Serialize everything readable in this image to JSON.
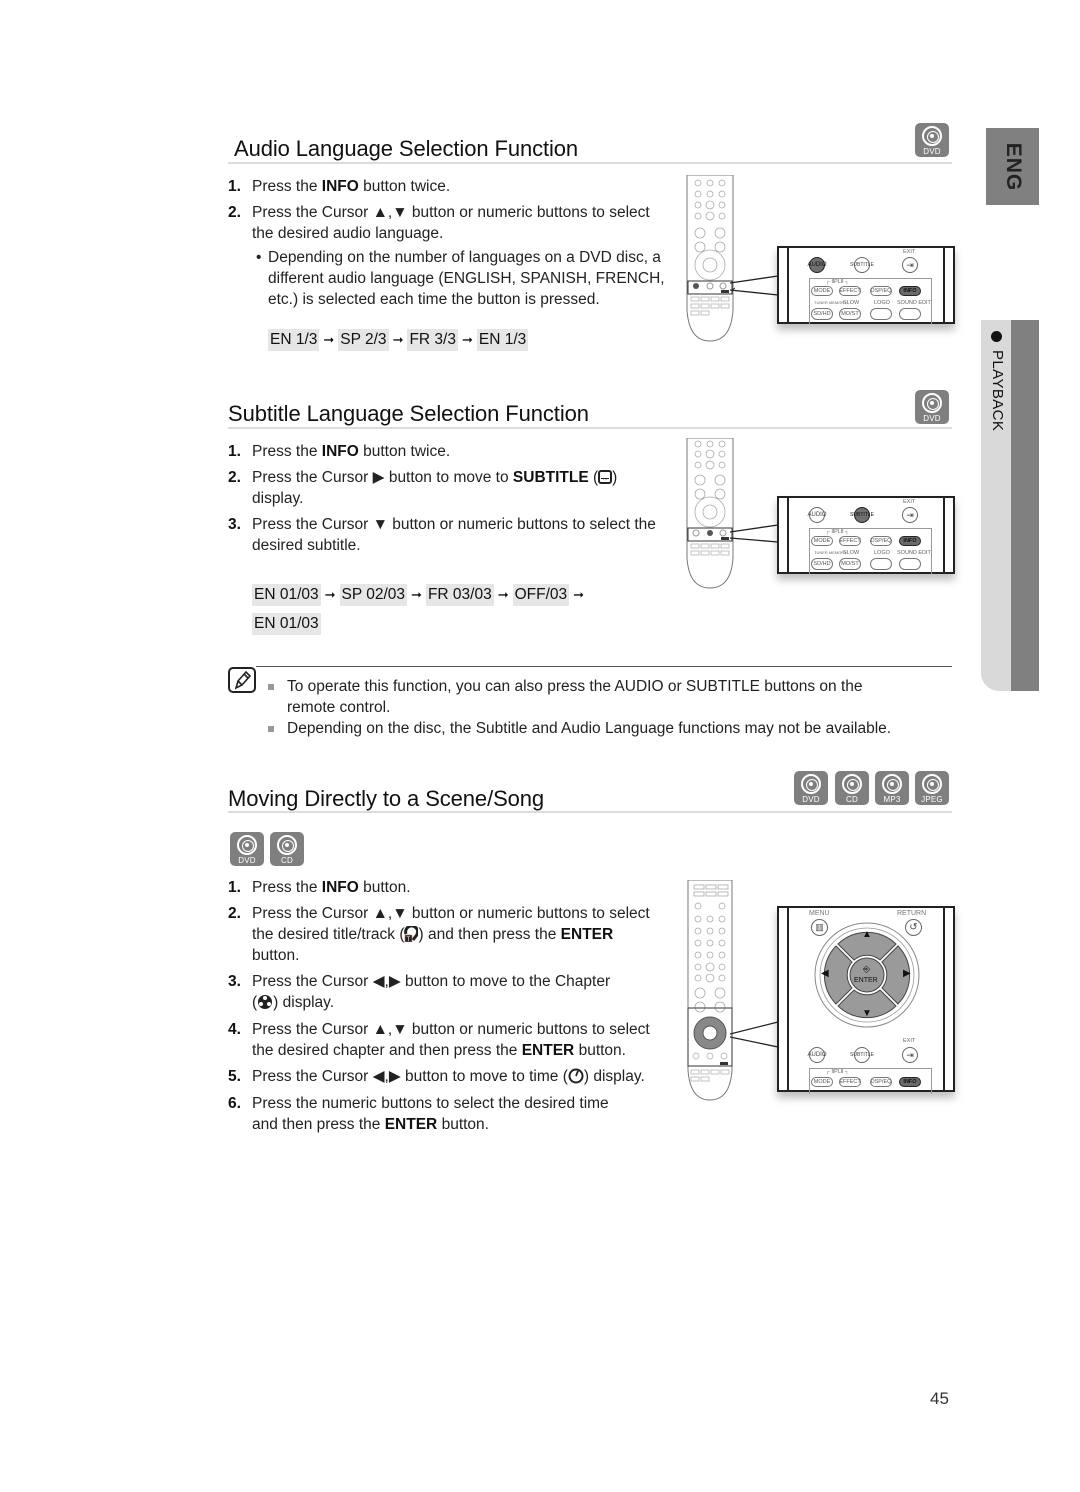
{
  "side_tabs": {
    "language": "ENG",
    "chapter": "PLAYBACK"
  },
  "page_number": "45",
  "sections": {
    "audio": {
      "title": "Audio Language Selection Function",
      "badges": [
        "DVD"
      ],
      "steps": [
        {
          "num": "1.",
          "pre": "Press the ",
          "bold": "INFO",
          "post": " button twice."
        },
        {
          "num": "2.",
          "line1": "Press the Cursor ▲,▼ button or numeric buttons to select",
          "line2": "the desired audio language."
        }
      ],
      "bullet": {
        "line1": "Depending on the number of languages on a DVD disc, a",
        "line2": "different audio language (ENGLISH, SPANISH, FRENCH,",
        "line3": "etc.) is selected each time the button is pressed."
      },
      "sequence": [
        "EN 1/3",
        "SP 2/3",
        "FR 3/3",
        "EN 1/3"
      ]
    },
    "subtitle": {
      "title": "Subtitle Language Selection Function",
      "badges": [
        "DVD"
      ],
      "steps": [
        {
          "num": "1.",
          "pre": "Press the ",
          "bold": "INFO",
          "post": " button twice."
        },
        {
          "num": "2.",
          "pre": "Press the Cursor ▶ button to move to ",
          "bold": "SUBTITLE",
          "post": " (",
          "post2": ")",
          "line2": "display."
        },
        {
          "num": "3.",
          "line1": "Press the Cursor ▼ button or numeric buttons to select the",
          "line2": "desired subtitle."
        }
      ],
      "sequence_line1": [
        "EN 01/03",
        "SP 02/03",
        "FR 03/03",
        "OFF/03"
      ],
      "sequence_line2": [
        "EN 01/03"
      ]
    },
    "note": {
      "items": [
        {
          "line1": "To operate this function, you can also press the AUDIO or SUBTITLE buttons on the",
          "line2": "remote control."
        },
        {
          "line1": "Depending on the disc, the Subtitle and Audio Language functions may not be available."
        }
      ]
    },
    "scene": {
      "title": "Moving Directly to a Scene/Song",
      "badges": [
        "DVD",
        "CD",
        "MP3",
        "JPEG"
      ],
      "sub_badges": [
        "DVD",
        "CD"
      ],
      "steps": [
        {
          "num": "1.",
          "pre": "Press the ",
          "bold": "INFO",
          "post": " button."
        },
        {
          "num": "2.",
          "line1": "Press the Cursor ▲,▼ button or numeric buttons to select",
          "line2_pre": "the desired title/track (",
          "line2_mid": ")  and then press the ",
          "line2_bold": "ENTER",
          "line3": "button."
        },
        {
          "num": "3.",
          "line1": "Press the Cursor ◀,▶ button to move to the Chapter",
          "line2_pre": "(",
          "line2_post": ") display."
        },
        {
          "num": "4.",
          "line1": "Press the Cursor ▲,▼ button or numeric buttons to select",
          "line2_pre": "the desired chapter and then press the ",
          "line2_bold": "ENTER",
          "line2_post": " button."
        },
        {
          "num": "5.",
          "pre": "Press the Cursor ◀,▶ button to move to time (",
          "post": ") display."
        },
        {
          "num": "6.",
          "line1": "Press the numeric buttons to select the desired time",
          "line2_pre": "and then press the ",
          "line2_bold": "ENTER",
          "line2_post": " button."
        }
      ]
    }
  },
  "remote_labels": {
    "audio": "AUDIO",
    "subtitle_1": "SUB",
    "subtitle_2": "TITLE",
    "exit": "EXIT",
    "pl2": "┌ ⅡPLⅡ ┐",
    "mode": "MODE",
    "effect": "EFFECT",
    "dspeq": "DSP/EQ",
    "info": "INFO",
    "tuner_memory": "TUNER MEMORY",
    "slow": "SLOW",
    "logo": "LOGO",
    "sound_edit": "SOUND EDIT",
    "sdhd": "SD/HD",
    "mostst": "MO/ST",
    "menu": "MENU",
    "return": "RETURN",
    "enter": "ENTER",
    "up": "▲",
    "down": "▼",
    "left": "◀",
    "right": "▶"
  }
}
